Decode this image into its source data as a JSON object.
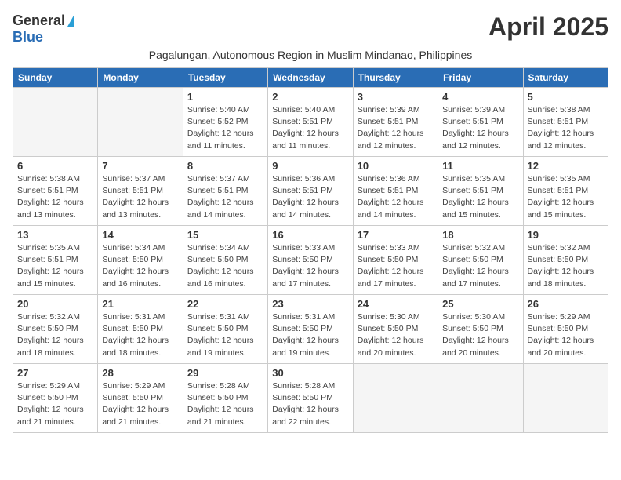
{
  "header": {
    "logo_general": "General",
    "logo_blue": "Blue",
    "month_title": "April 2025",
    "subtitle": "Pagalungan, Autonomous Region in Muslim Mindanao, Philippines"
  },
  "weekdays": [
    "Sunday",
    "Monday",
    "Tuesday",
    "Wednesday",
    "Thursday",
    "Friday",
    "Saturday"
  ],
  "weeks": [
    [
      {
        "day": "",
        "info": ""
      },
      {
        "day": "",
        "info": ""
      },
      {
        "day": "1",
        "info": "Sunrise: 5:40 AM\nSunset: 5:52 PM\nDaylight: 12 hours and 11 minutes."
      },
      {
        "day": "2",
        "info": "Sunrise: 5:40 AM\nSunset: 5:51 PM\nDaylight: 12 hours and 11 minutes."
      },
      {
        "day": "3",
        "info": "Sunrise: 5:39 AM\nSunset: 5:51 PM\nDaylight: 12 hours and 12 minutes."
      },
      {
        "day": "4",
        "info": "Sunrise: 5:39 AM\nSunset: 5:51 PM\nDaylight: 12 hours and 12 minutes."
      },
      {
        "day": "5",
        "info": "Sunrise: 5:38 AM\nSunset: 5:51 PM\nDaylight: 12 hours and 12 minutes."
      }
    ],
    [
      {
        "day": "6",
        "info": "Sunrise: 5:38 AM\nSunset: 5:51 PM\nDaylight: 12 hours and 13 minutes."
      },
      {
        "day": "7",
        "info": "Sunrise: 5:37 AM\nSunset: 5:51 PM\nDaylight: 12 hours and 13 minutes."
      },
      {
        "day": "8",
        "info": "Sunrise: 5:37 AM\nSunset: 5:51 PM\nDaylight: 12 hours and 14 minutes."
      },
      {
        "day": "9",
        "info": "Sunrise: 5:36 AM\nSunset: 5:51 PM\nDaylight: 12 hours and 14 minutes."
      },
      {
        "day": "10",
        "info": "Sunrise: 5:36 AM\nSunset: 5:51 PM\nDaylight: 12 hours and 14 minutes."
      },
      {
        "day": "11",
        "info": "Sunrise: 5:35 AM\nSunset: 5:51 PM\nDaylight: 12 hours and 15 minutes."
      },
      {
        "day": "12",
        "info": "Sunrise: 5:35 AM\nSunset: 5:51 PM\nDaylight: 12 hours and 15 minutes."
      }
    ],
    [
      {
        "day": "13",
        "info": "Sunrise: 5:35 AM\nSunset: 5:51 PM\nDaylight: 12 hours and 15 minutes."
      },
      {
        "day": "14",
        "info": "Sunrise: 5:34 AM\nSunset: 5:50 PM\nDaylight: 12 hours and 16 minutes."
      },
      {
        "day": "15",
        "info": "Sunrise: 5:34 AM\nSunset: 5:50 PM\nDaylight: 12 hours and 16 minutes."
      },
      {
        "day": "16",
        "info": "Sunrise: 5:33 AM\nSunset: 5:50 PM\nDaylight: 12 hours and 17 minutes."
      },
      {
        "day": "17",
        "info": "Sunrise: 5:33 AM\nSunset: 5:50 PM\nDaylight: 12 hours and 17 minutes."
      },
      {
        "day": "18",
        "info": "Sunrise: 5:32 AM\nSunset: 5:50 PM\nDaylight: 12 hours and 17 minutes."
      },
      {
        "day": "19",
        "info": "Sunrise: 5:32 AM\nSunset: 5:50 PM\nDaylight: 12 hours and 18 minutes."
      }
    ],
    [
      {
        "day": "20",
        "info": "Sunrise: 5:32 AM\nSunset: 5:50 PM\nDaylight: 12 hours and 18 minutes."
      },
      {
        "day": "21",
        "info": "Sunrise: 5:31 AM\nSunset: 5:50 PM\nDaylight: 12 hours and 18 minutes."
      },
      {
        "day": "22",
        "info": "Sunrise: 5:31 AM\nSunset: 5:50 PM\nDaylight: 12 hours and 19 minutes."
      },
      {
        "day": "23",
        "info": "Sunrise: 5:31 AM\nSunset: 5:50 PM\nDaylight: 12 hours and 19 minutes."
      },
      {
        "day": "24",
        "info": "Sunrise: 5:30 AM\nSunset: 5:50 PM\nDaylight: 12 hours and 20 minutes."
      },
      {
        "day": "25",
        "info": "Sunrise: 5:30 AM\nSunset: 5:50 PM\nDaylight: 12 hours and 20 minutes."
      },
      {
        "day": "26",
        "info": "Sunrise: 5:29 AM\nSunset: 5:50 PM\nDaylight: 12 hours and 20 minutes."
      }
    ],
    [
      {
        "day": "27",
        "info": "Sunrise: 5:29 AM\nSunset: 5:50 PM\nDaylight: 12 hours and 21 minutes."
      },
      {
        "day": "28",
        "info": "Sunrise: 5:29 AM\nSunset: 5:50 PM\nDaylight: 12 hours and 21 minutes."
      },
      {
        "day": "29",
        "info": "Sunrise: 5:28 AM\nSunset: 5:50 PM\nDaylight: 12 hours and 21 minutes."
      },
      {
        "day": "30",
        "info": "Sunrise: 5:28 AM\nSunset: 5:50 PM\nDaylight: 12 hours and 22 minutes."
      },
      {
        "day": "",
        "info": ""
      },
      {
        "day": "",
        "info": ""
      },
      {
        "day": "",
        "info": ""
      }
    ]
  ]
}
